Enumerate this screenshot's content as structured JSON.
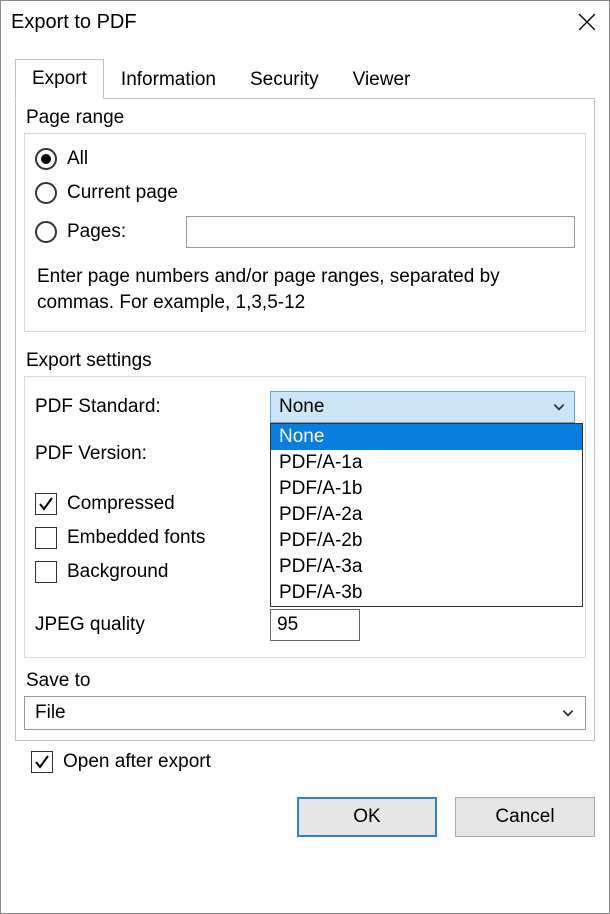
{
  "title": "Export to PDF",
  "tabs": [
    "Export",
    "Information",
    "Security",
    "Viewer"
  ],
  "activeTab": 0,
  "pageRange": {
    "label": "Page range",
    "options": {
      "all": "All",
      "current": "Current page",
      "pages": "Pages:"
    },
    "selected": "all",
    "pagesValue": "",
    "hint": "Enter page numbers and/or page ranges, separated by commas. For example, 1,3,5-12"
  },
  "exportSettings": {
    "label": "Export settings",
    "pdfStandardLabel": "PDF Standard:",
    "pdfStandardValue": "None",
    "pdfStandardOptions": [
      "None",
      "PDF/A-1a",
      "PDF/A-1b",
      "PDF/A-2a",
      "PDF/A-2b",
      "PDF/A-3a",
      "PDF/A-3b"
    ],
    "pdfStandardHighlight": 0,
    "pdfVersionLabel": "PDF Version:",
    "compressedLabel": "Compressed",
    "compressedChecked": true,
    "embeddedFontsLabel": "Embedded fonts",
    "embeddedFontsChecked": false,
    "backgroundLabel": "Background",
    "backgroundChecked": false,
    "jpegQualityLabel": "JPEG quality",
    "jpegQualityValue": "95"
  },
  "saveTo": {
    "label": "Save to",
    "value": "File"
  },
  "openAfter": {
    "label": "Open after export",
    "checked": true
  },
  "buttons": {
    "ok": "OK",
    "cancel": "Cancel"
  }
}
